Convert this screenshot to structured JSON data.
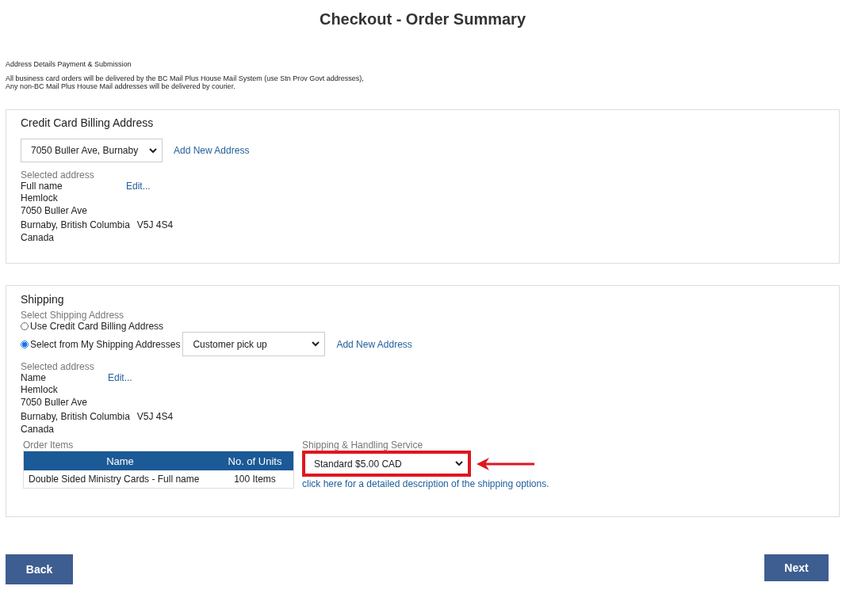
{
  "page_title": "Checkout - Order Summary",
  "steps": "Address Details Payment & Submission",
  "notice": [
    "All business card orders will be delivered by the BC Mail Plus House Mail System (use Stn Prov Govt addresses),",
    "Any non-BC Mail Plus House Mail addresses will be delivered by courier."
  ],
  "billing": {
    "title": "Credit Card Billing Address",
    "address_select": "7050 Buller Ave, Burnaby",
    "add_link": "Add New Address",
    "selected_label": "Selected address",
    "name": "Full name",
    "edit_link": "Edit...",
    "lines": [
      "Hemlock",
      "7050 Buller Ave"
    ],
    "city": "Burnaby, British Columbia",
    "postal": "V5J 4S4",
    "country": "Canada"
  },
  "shipping": {
    "title": "Shipping",
    "select_label": "Select Shipping Address",
    "options": [
      {
        "label": "Use Credit Card Billing Address",
        "selected": false
      },
      {
        "label": "Select from My Shipping Addresses",
        "selected": true
      }
    ],
    "address_select": "Customer pick up",
    "add_link": "Add New Address",
    "selected_label": "Selected address",
    "name": "Name",
    "edit_link": "Edit...",
    "lines": [
      "Hemlock",
      "7050 Buller Ave"
    ],
    "city": "Burnaby, British Columbia",
    "postal": "V5J 4S4",
    "country": "Canada",
    "order_items": {
      "label": "Order Items",
      "columns": [
        "Name",
        "No. of Units"
      ],
      "rows": [
        [
          "Double Sided Ministry Cards - Full name",
          "100 Items"
        ]
      ]
    },
    "service": {
      "label": "Shipping & Handling Service",
      "value": "Standard $5.00 CAD",
      "link": "click here for a detailed description of the shipping options."
    }
  },
  "buttons": {
    "back": "Back",
    "next": "Next"
  }
}
